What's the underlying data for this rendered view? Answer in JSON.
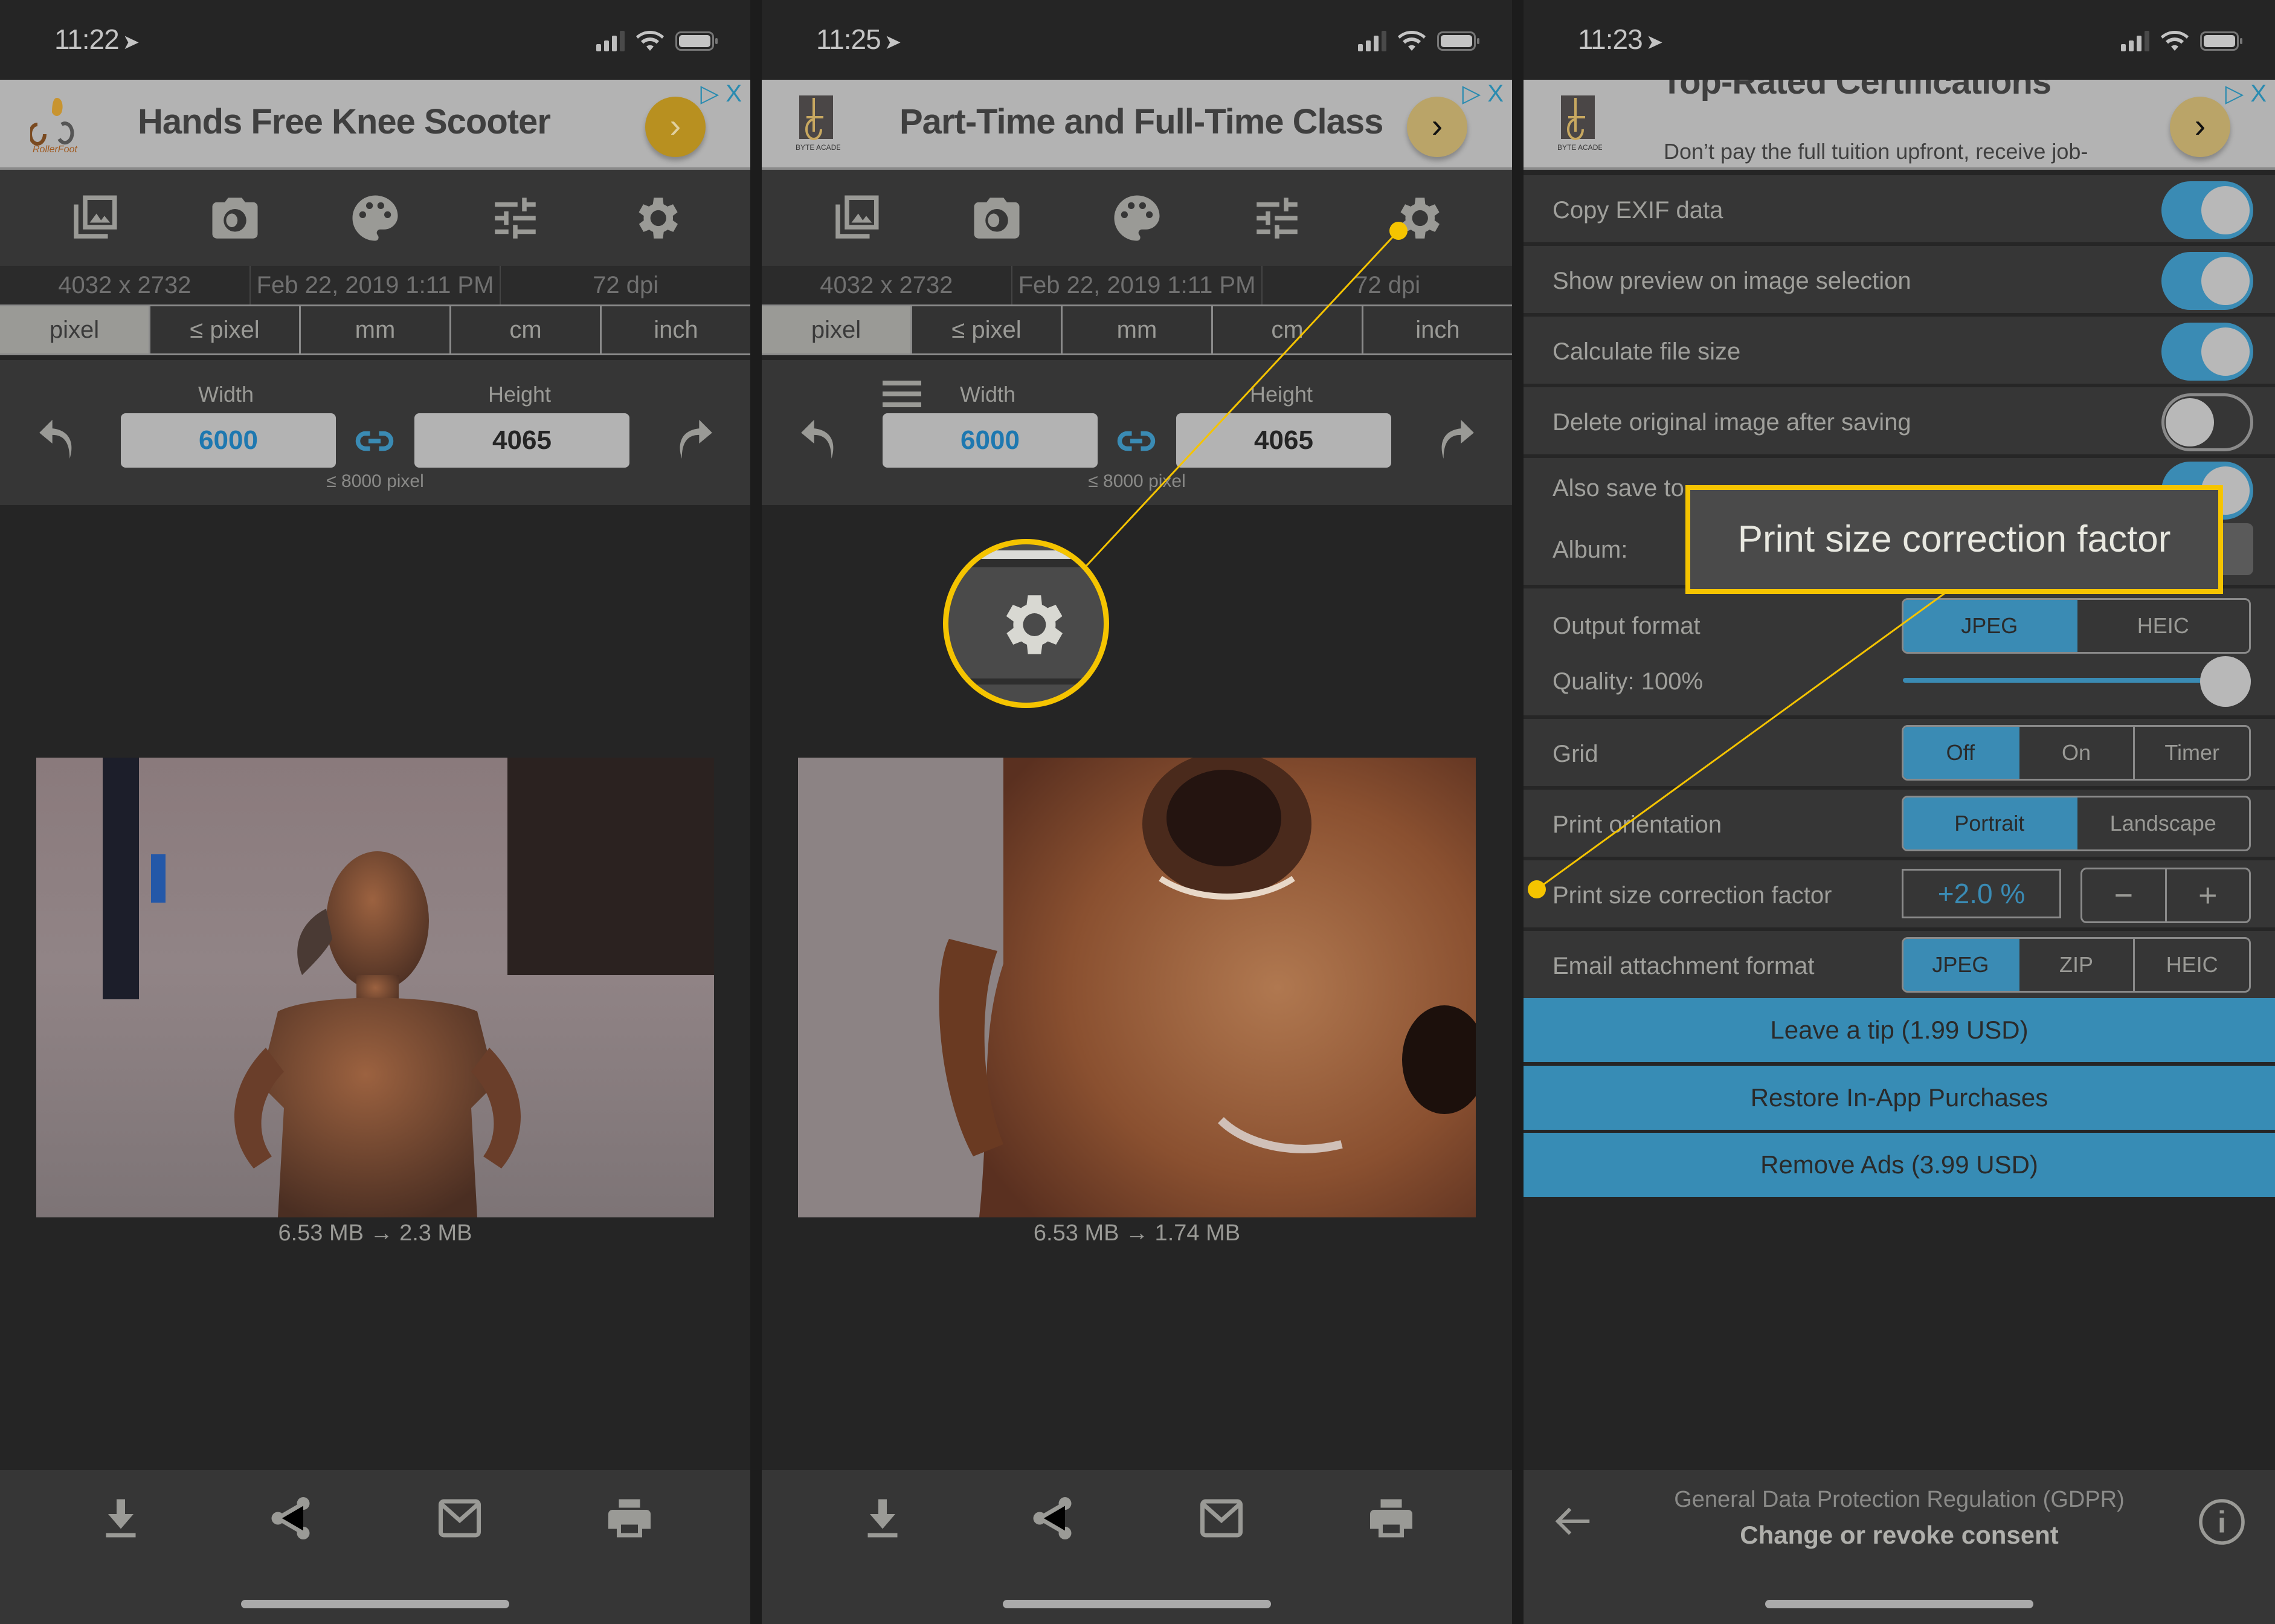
{
  "panels": [
    {
      "status": {
        "time": "11:22"
      },
      "ad": {
        "title": "Hands Free Knee Scooter",
        "logo_text": "RollerFoot",
        "go_icon": "chevron-right-icon",
        "adchoices_label": "▷ X"
      },
      "toolbar": [
        "gallery-icon",
        "camera-icon",
        "palette-icon",
        "sliders-icon",
        "gear-icon"
      ],
      "info": {
        "dimensions": "4032 x 2732",
        "date": "Feb 22, 2019 1:11 PM",
        "dpi": "72 dpi"
      },
      "units": {
        "items": [
          "pixel",
          "≤ pixel",
          "mm",
          "cm",
          "inch"
        ],
        "selected": "pixel"
      },
      "dims": {
        "width_label": "Width",
        "height_label": "Height",
        "width_value": "6000",
        "height_value": "4065",
        "limit": "≤ 8000 pixel"
      },
      "photo_desc": "Bronze girl statue, full upper body",
      "file_size": "6.53 MB  →  2.3 MB",
      "bottom": [
        "download-icon",
        "share-icon",
        "mail-icon",
        "print-icon"
      ]
    },
    {
      "status": {
        "time": "11:25"
      },
      "ad": {
        "title": "Part-Time and Full-Time Class",
        "logo_text": "BYTE ACADEMY",
        "go_icon": "chevron-right-icon",
        "adchoices_label": "▷ X"
      },
      "toolbar": [
        "gallery-icon",
        "camera-icon",
        "palette-icon",
        "sliders-icon",
        "gear-icon"
      ],
      "info": {
        "dimensions": "4032 x 2732",
        "date": "Feb 22, 2019 1:11 PM",
        "dpi": "72 dpi"
      },
      "units": {
        "items": [
          "pixel",
          "≤ pixel",
          "mm",
          "cm",
          "inch"
        ],
        "selected": "pixel"
      },
      "dims": {
        "width_label": "Width",
        "height_label": "Height",
        "width_value": "6000",
        "height_value": "4065",
        "limit": "≤ 8000 pixel"
      },
      "photo_desc": "Close-up of bronze statue face",
      "file_size": "6.53 MB  →  1.74 MB",
      "bottom": [
        "download-icon",
        "share-icon",
        "mail-icon",
        "print-icon"
      ]
    }
  ],
  "settings_panel": {
    "status": {
      "time": "11:23"
    },
    "ad": {
      "title": "Top-Rated Certifications",
      "description": "Don’t pay the full tuition upfront, receive job-",
      "logo_text": "BYTE ACADEMY",
      "adchoices_label": "▷ X"
    },
    "toggles": [
      {
        "label": "Copy EXIF data",
        "on": true
      },
      {
        "label": "Show preview on image selection",
        "on": true
      },
      {
        "label": "Calculate file size",
        "on": true
      },
      {
        "label": "Delete original image after saving",
        "on": false
      },
      {
        "label": "Also save to album",
        "visible_label": "Also save to",
        "on": true
      }
    ],
    "album_label": "Album:",
    "output_format": {
      "label": "Output format",
      "options": [
        "JPEG",
        "HEIC"
      ],
      "selected": "JPEG"
    },
    "quality": {
      "label": "Quality: 100%",
      "value_percent": 100
    },
    "grid": {
      "label": "Grid",
      "options": [
        "Off",
        "On",
        "Timer"
      ],
      "selected": "Off"
    },
    "print_orientation": {
      "label": "Print orientation",
      "options": [
        "Portrait",
        "Landscape"
      ],
      "selected": "Portrait"
    },
    "print_size_correction": {
      "label": "Print size correction factor",
      "value": "+2.0 %",
      "decrement": "−",
      "increment": "+"
    },
    "email_format": {
      "label": "Email attachment format",
      "options": [
        "JPEG",
        "ZIP",
        "HEIC"
      ],
      "selected": "JPEG"
    },
    "buttons": [
      "Leave a tip (1.99 USD)",
      "Restore In-App Purchases",
      "Remove Ads (3.99 USD)"
    ],
    "gdpr": {
      "title": "General Data Protection Regulation (GDPR)",
      "action": "Change or revoke consent"
    }
  },
  "annotations": {
    "tooltip_text": "Print size correction factor",
    "highlight_color": "#f5c400"
  },
  "colors": {
    "accent": "#378cb5",
    "background": "#252525",
    "panel": "#363636"
  }
}
